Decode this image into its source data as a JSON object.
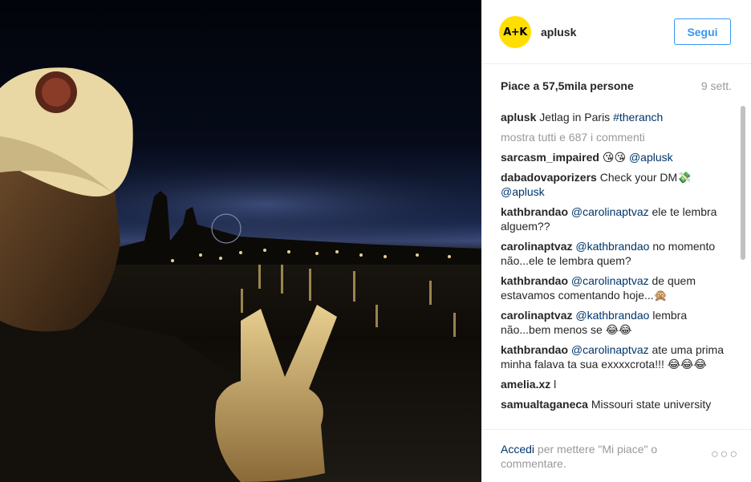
{
  "post": {
    "username": "aplusk",
    "avatar_text": "A+K",
    "follow_label": "Segui",
    "likes": "Piace a 57,5mila persone",
    "time": "9 sett."
  },
  "caption": {
    "user": "aplusk",
    "text": "Jetlag in Paris",
    "hashtag": "#theranch"
  },
  "show_all": "mostra tutti e 687 i commenti",
  "comments": [
    {
      "user": "sarcasm_impaired",
      "text": "😘😘",
      "mention": "@aplusk",
      "after": ""
    },
    {
      "user": "dabadovaporizers",
      "text": "Check your DM💸",
      "mention": "@aplusk",
      "after": ""
    },
    {
      "user": "kathbrandao",
      "text": "",
      "mention": "@carolinaptvaz",
      "after": "ele te lembra alguem??"
    },
    {
      "user": "carolinaptvaz",
      "text": "",
      "mention": "@kathbrandao",
      "after": "no momento não...ele te lembra quem?"
    },
    {
      "user": "kathbrandao",
      "text": "",
      "mention": "@carolinaptvaz",
      "after": "de quem estavamos comentando hoje...🙊"
    },
    {
      "user": "carolinaptvaz",
      "text": "",
      "mention": "@kathbrandao",
      "after": "lembra não...bem menos se 😂😂"
    },
    {
      "user": "kathbrandao",
      "text": "",
      "mention": "@carolinaptvaz",
      "after": "ate uma prima minha falava ta sua exxxxcrota!!! 😂😂😂"
    },
    {
      "user": "amelia.xz",
      "text": "l",
      "mention": "",
      "after": ""
    },
    {
      "user": "samualtaganeca",
      "text": "Missouri state university",
      "mention": "",
      "after": ""
    }
  ],
  "footer": {
    "login_link": "Accedi",
    "login_text": " per mettere \"Mi piace\" o commentare.",
    "more": "○○○"
  },
  "colors": {
    "accent": "#3897f0",
    "link": "#003569",
    "muted": "#999999",
    "avatar_bg": "#ffde00"
  },
  "icons": [
    "more-options-icon"
  ]
}
